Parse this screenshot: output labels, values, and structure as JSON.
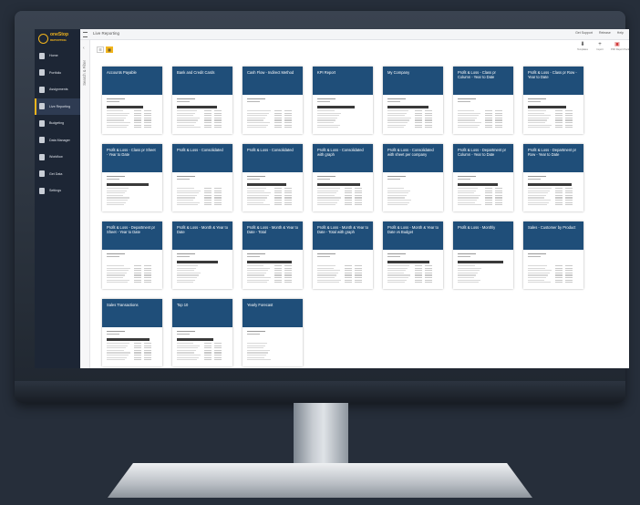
{
  "app": {
    "brand_line1": "oneStop",
    "brand_line2": "REPORTING",
    "page_title": "Live Reporting",
    "top_links": [
      "Get Support",
      "Release",
      "Help"
    ]
  },
  "sidebar": {
    "items": [
      {
        "label": "Home",
        "icon": "home-icon"
      },
      {
        "label": "Portfolio",
        "icon": "portfolio-icon"
      },
      {
        "label": "Assignments",
        "icon": "assignments-icon"
      },
      {
        "label": "Live Reporting",
        "icon": "reporting-icon",
        "active": true
      },
      {
        "label": "Budgeting",
        "icon": "budget-icon"
      },
      {
        "label": "Data Manager",
        "icon": "data-icon"
      },
      {
        "label": "Workflow",
        "icon": "workflow-icon"
      },
      {
        "label": "Get Data",
        "icon": "download-icon"
      },
      {
        "label": "Settings",
        "icon": "gear-icon"
      }
    ]
  },
  "filters": {
    "rail_label": "Search & Filter",
    "collapse_glyph": "‹",
    "list_glyph": "☰",
    "tiles_glyph": "▦"
  },
  "actions": [
    {
      "label": "Templates",
      "glyph": "⬇",
      "icon": "template-icon"
    },
    {
      "label": "Import",
      "glyph": "+",
      "icon": "import-icon"
    },
    {
      "label": "PDF Report Pack",
      "glyph": "▣",
      "icon": "pdf-icon",
      "accent": true
    }
  ],
  "reports": [
    "Accounts Payable",
    "Bank and Credit Cards",
    "Cash Flow - Indirect Method",
    "KPI Report",
    "My Company",
    "Profit & Loss - Class pr Column - Year to Date",
    "Profit & Loss - Class pr Row - Year to Date",
    "Profit & Loss - Class pr Sheet - Year to Date",
    "Profit & Loss - Consolidated",
    "Profit & Loss - Consolidated",
    "Profit & Loss - Consolidated with graph",
    "Profit & Loss - Consolidated with sheet per company",
    "Profit & Loss - Department pr Column - Year to Date",
    "Profit & Loss - Department pr Row - Year to Date",
    "Profit & Loss - Department pr Sheet - Year to Date",
    "Profit & Loss - Month & Year to Date",
    "Profit & Loss - Month & Year to Date - Total",
    "Profit & Loss - Month & Year to Date - Total with graph",
    "Profit & Loss - Month & Year to Date vs Budget",
    "Profit & Loss - Monthly",
    "Sales - Customer by Product",
    "Sales Transactions",
    "Top 10",
    "Yearly Forecast"
  ],
  "colors": {
    "card_header": "#1f4e79",
    "accent": "#f2b51d",
    "sidebar": "#1d2635"
  }
}
